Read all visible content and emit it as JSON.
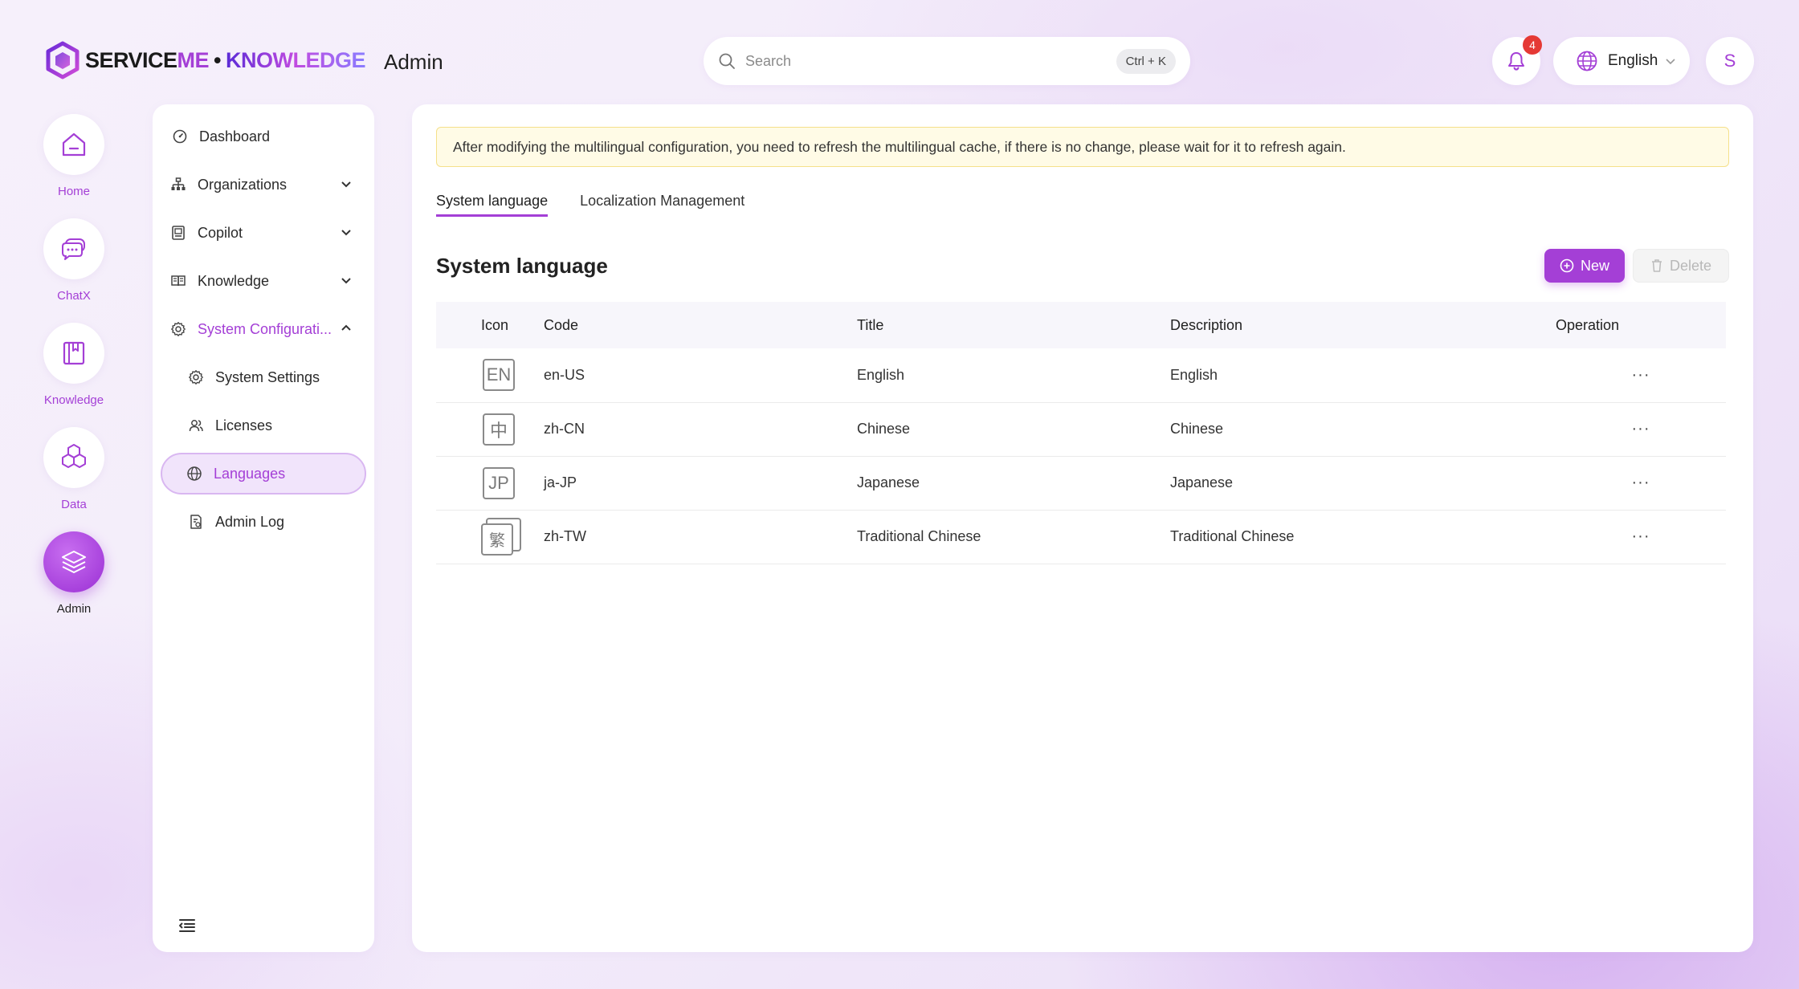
{
  "brand": {
    "logo_service": "SERVICE",
    "logo_me": "ME",
    "logo_dot": "•",
    "logo_knowledge": "KNOWLEDGE",
    "app_title": "Admin",
    "accent_color": "#a43fd6"
  },
  "search": {
    "placeholder": "Search",
    "shortcut": "Ctrl + K"
  },
  "header": {
    "notification_count": "4",
    "language": "English",
    "avatar_initial": "S"
  },
  "rail": {
    "items": [
      {
        "label": "Home",
        "icon": "home-icon"
      },
      {
        "label": "ChatX",
        "icon": "chat-icon"
      },
      {
        "label": "Knowledge",
        "icon": "book-icon"
      },
      {
        "label": "Data",
        "icon": "hexagons-icon"
      },
      {
        "label": "Admin",
        "icon": "layers-icon",
        "active": true
      }
    ]
  },
  "nav": {
    "items": [
      {
        "label": "Dashboard",
        "icon": "dashboard-icon"
      },
      {
        "label": "Organizations",
        "icon": "org-icon",
        "expandable": true
      },
      {
        "label": "Copilot",
        "icon": "copilot-icon",
        "expandable": true
      },
      {
        "label": "Knowledge",
        "icon": "book-open-icon",
        "expandable": true
      },
      {
        "label": "System Configurati...",
        "icon": "gear-icon",
        "expanded": true
      },
      {
        "label": "System Settings",
        "icon": "gear-icon"
      },
      {
        "label": "Licenses",
        "icon": "users-icon"
      },
      {
        "label": "Languages",
        "icon": "globe-icon",
        "active": true
      },
      {
        "label": "Admin Log",
        "icon": "log-icon"
      }
    ]
  },
  "main": {
    "notice": "After modifying the multilingual configuration, you need to refresh the multilingual cache, if there is no change, please wait for it to refresh again.",
    "tabs": [
      "System language",
      "Localization Management"
    ],
    "section_title": "System language",
    "new_label": "New",
    "delete_label": "Delete",
    "table": {
      "headers": [
        "Icon",
        "Code",
        "Title",
        "Description",
        "Operation"
      ],
      "rows": [
        {
          "icon_text": "EN",
          "code": "en-US",
          "title": "English",
          "description": "English",
          "op": "···"
        },
        {
          "icon_text": "中",
          "code": "zh-CN",
          "title": "Chinese",
          "description": "Chinese",
          "op": "···"
        },
        {
          "icon_text": "JP",
          "code": "ja-JP",
          "title": "Japanese",
          "description": "Japanese",
          "op": "···"
        },
        {
          "icon_text": "繁",
          "code": "zh-TW",
          "title": "Traditional Chinese",
          "description": "Traditional Chinese",
          "op": "···"
        }
      ]
    }
  }
}
